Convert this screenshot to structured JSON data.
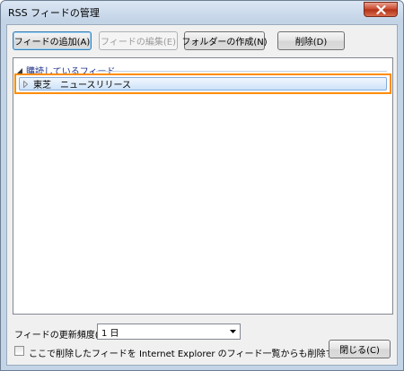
{
  "window": {
    "title": "RSS フィードの管理",
    "close_icon": "close-icon"
  },
  "toolbar": {
    "add_label": "フィードの追加(A)",
    "edit_label": "フィードの編集(E)",
    "new_folder_label": "フォルダーの作成(N)",
    "delete_label": "削除(D)"
  },
  "tree": {
    "group_label": "購読しているフィード",
    "items": [
      {
        "label": "東芝　ニュースリリース"
      }
    ]
  },
  "frequency": {
    "label": "フィードの更新頻度(U):",
    "value": "1 日"
  },
  "option": {
    "checkbox_label": "ここで削除したフィードを Internet Explorer のフィード一覧からも削除する(F)",
    "checked": false
  },
  "footer": {
    "close_label": "閉じる(C)"
  },
  "colors": {
    "highlight": "#ff8c00",
    "selection": "#cde2f8",
    "group_text": "#1e3287"
  }
}
